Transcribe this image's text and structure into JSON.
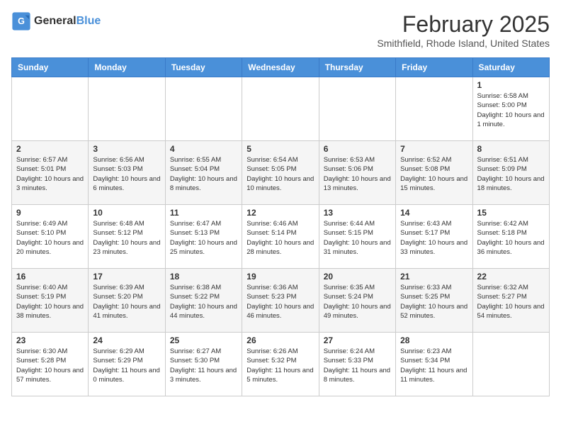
{
  "header": {
    "logo": {
      "general": "General",
      "blue": "Blue"
    },
    "title": "February 2025",
    "subtitle": "Smithfield, Rhode Island, United States"
  },
  "calendar": {
    "days_of_week": [
      "Sunday",
      "Monday",
      "Tuesday",
      "Wednesday",
      "Thursday",
      "Friday",
      "Saturday"
    ],
    "weeks": [
      [
        {
          "day": "",
          "info": ""
        },
        {
          "day": "",
          "info": ""
        },
        {
          "day": "",
          "info": ""
        },
        {
          "day": "",
          "info": ""
        },
        {
          "day": "",
          "info": ""
        },
        {
          "day": "",
          "info": ""
        },
        {
          "day": "1",
          "info": "Sunrise: 6:58 AM\nSunset: 5:00 PM\nDaylight: 10 hours and 1 minute."
        }
      ],
      [
        {
          "day": "2",
          "info": "Sunrise: 6:57 AM\nSunset: 5:01 PM\nDaylight: 10 hours and 3 minutes."
        },
        {
          "day": "3",
          "info": "Sunrise: 6:56 AM\nSunset: 5:03 PM\nDaylight: 10 hours and 6 minutes."
        },
        {
          "day": "4",
          "info": "Sunrise: 6:55 AM\nSunset: 5:04 PM\nDaylight: 10 hours and 8 minutes."
        },
        {
          "day": "5",
          "info": "Sunrise: 6:54 AM\nSunset: 5:05 PM\nDaylight: 10 hours and 10 minutes."
        },
        {
          "day": "6",
          "info": "Sunrise: 6:53 AM\nSunset: 5:06 PM\nDaylight: 10 hours and 13 minutes."
        },
        {
          "day": "7",
          "info": "Sunrise: 6:52 AM\nSunset: 5:08 PM\nDaylight: 10 hours and 15 minutes."
        },
        {
          "day": "8",
          "info": "Sunrise: 6:51 AM\nSunset: 5:09 PM\nDaylight: 10 hours and 18 minutes."
        }
      ],
      [
        {
          "day": "9",
          "info": "Sunrise: 6:49 AM\nSunset: 5:10 PM\nDaylight: 10 hours and 20 minutes."
        },
        {
          "day": "10",
          "info": "Sunrise: 6:48 AM\nSunset: 5:12 PM\nDaylight: 10 hours and 23 minutes."
        },
        {
          "day": "11",
          "info": "Sunrise: 6:47 AM\nSunset: 5:13 PM\nDaylight: 10 hours and 25 minutes."
        },
        {
          "day": "12",
          "info": "Sunrise: 6:46 AM\nSunset: 5:14 PM\nDaylight: 10 hours and 28 minutes."
        },
        {
          "day": "13",
          "info": "Sunrise: 6:44 AM\nSunset: 5:15 PM\nDaylight: 10 hours and 31 minutes."
        },
        {
          "day": "14",
          "info": "Sunrise: 6:43 AM\nSunset: 5:17 PM\nDaylight: 10 hours and 33 minutes."
        },
        {
          "day": "15",
          "info": "Sunrise: 6:42 AM\nSunset: 5:18 PM\nDaylight: 10 hours and 36 minutes."
        }
      ],
      [
        {
          "day": "16",
          "info": "Sunrise: 6:40 AM\nSunset: 5:19 PM\nDaylight: 10 hours and 38 minutes."
        },
        {
          "day": "17",
          "info": "Sunrise: 6:39 AM\nSunset: 5:20 PM\nDaylight: 10 hours and 41 minutes."
        },
        {
          "day": "18",
          "info": "Sunrise: 6:38 AM\nSunset: 5:22 PM\nDaylight: 10 hours and 44 minutes."
        },
        {
          "day": "19",
          "info": "Sunrise: 6:36 AM\nSunset: 5:23 PM\nDaylight: 10 hours and 46 minutes."
        },
        {
          "day": "20",
          "info": "Sunrise: 6:35 AM\nSunset: 5:24 PM\nDaylight: 10 hours and 49 minutes."
        },
        {
          "day": "21",
          "info": "Sunrise: 6:33 AM\nSunset: 5:25 PM\nDaylight: 10 hours and 52 minutes."
        },
        {
          "day": "22",
          "info": "Sunrise: 6:32 AM\nSunset: 5:27 PM\nDaylight: 10 hours and 54 minutes."
        }
      ],
      [
        {
          "day": "23",
          "info": "Sunrise: 6:30 AM\nSunset: 5:28 PM\nDaylight: 10 hours and 57 minutes."
        },
        {
          "day": "24",
          "info": "Sunrise: 6:29 AM\nSunset: 5:29 PM\nDaylight: 11 hours and 0 minutes."
        },
        {
          "day": "25",
          "info": "Sunrise: 6:27 AM\nSunset: 5:30 PM\nDaylight: 11 hours and 3 minutes."
        },
        {
          "day": "26",
          "info": "Sunrise: 6:26 AM\nSunset: 5:32 PM\nDaylight: 11 hours and 5 minutes."
        },
        {
          "day": "27",
          "info": "Sunrise: 6:24 AM\nSunset: 5:33 PM\nDaylight: 11 hours and 8 minutes."
        },
        {
          "day": "28",
          "info": "Sunrise: 6:23 AM\nSunset: 5:34 PM\nDaylight: 11 hours and 11 minutes."
        },
        {
          "day": "",
          "info": ""
        }
      ]
    ]
  }
}
